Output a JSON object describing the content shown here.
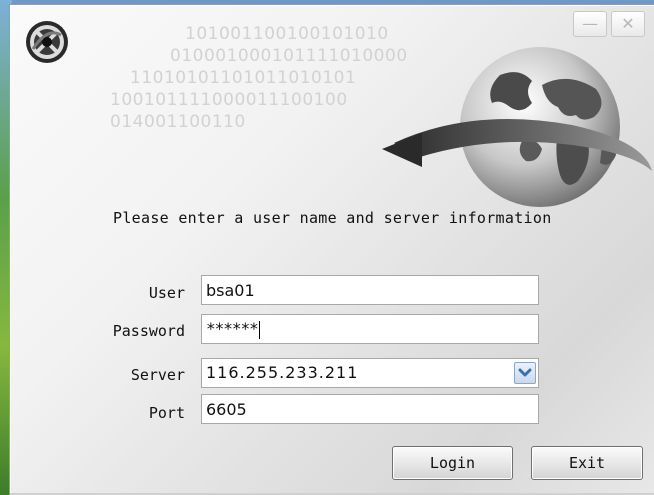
{
  "window": {
    "background_binary": [
      "101001100100101010",
      "010001000101111010000",
      "11010101101011010101",
      "100101111000011100100",
      "014001100110"
    ],
    "minimize_label": "—",
    "close_label": "✕"
  },
  "prompt": "Please enter a user name and server information",
  "form": {
    "user_label": "User",
    "user_value": "bsa01",
    "password_label": "Password",
    "password_value": "******",
    "server_label": "Server",
    "server_value": "116.255.233.211",
    "port_label": "Port",
    "port_value": "6605"
  },
  "buttons": {
    "login": "Login",
    "exit": "Exit"
  },
  "icons": {
    "app_logo": "app-logo-icon",
    "globe": "globe-icon",
    "dropdown": "chevron-down-icon"
  },
  "colors": {
    "dropdown_arrow": "#3b6fb3",
    "field_border": "#a8a8a8"
  }
}
